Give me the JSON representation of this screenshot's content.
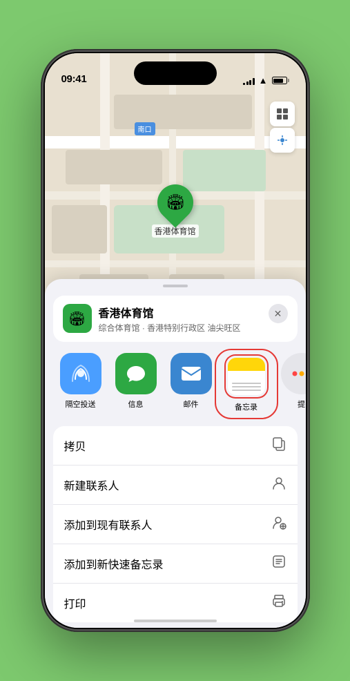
{
  "status": {
    "time": "09:41",
    "location_arrow": "▲"
  },
  "map": {
    "label_south": "南口",
    "stadium_name": "香港体育馆",
    "pin_emoji": "🏟"
  },
  "venue_card": {
    "name": "香港体育馆",
    "subtitle": "综合体育馆 · 香港特别行政区 油尖旺区",
    "close_label": "✕"
  },
  "share_items": [
    {
      "label": "隔空投送",
      "type": "airdrop"
    },
    {
      "label": "信息",
      "type": "messages"
    },
    {
      "label": "邮件",
      "type": "mail"
    },
    {
      "label": "备忘录",
      "type": "notes"
    },
    {
      "label": "提",
      "type": "more"
    }
  ],
  "actions": [
    {
      "label": "拷贝",
      "icon": "📋"
    },
    {
      "label": "新建联系人",
      "icon": "👤"
    },
    {
      "label": "添加到现有联系人",
      "icon": "👤"
    },
    {
      "label": "添加到新快速备忘录",
      "icon": "📝"
    },
    {
      "label": "打印",
      "icon": "🖨"
    }
  ]
}
